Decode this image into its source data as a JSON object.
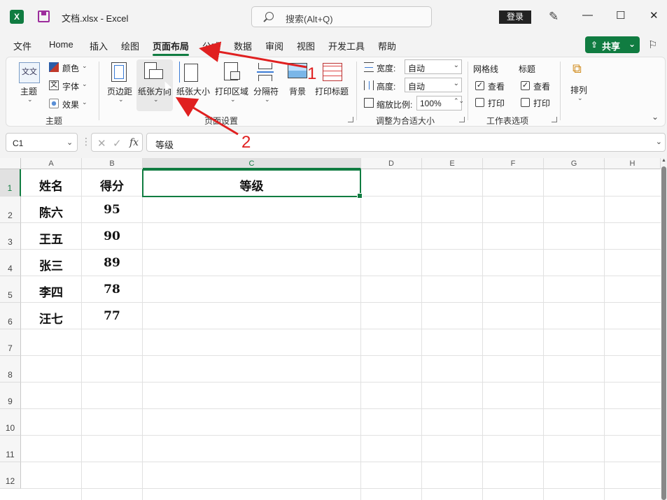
{
  "window": {
    "title": "文档.xlsx  -  Excel",
    "app_icon": "X",
    "search_placeholder": "搜索(Alt+Q)",
    "login_label": "登录",
    "pen_icon": "✎",
    "minimize": "—",
    "maximize": "☐",
    "close": "✕"
  },
  "menu": {
    "tabs": [
      "文件",
      "Home",
      "插入",
      "绘图",
      "页面布局",
      "公式",
      "数据",
      "审阅",
      "视图",
      "开发工具",
      "帮助"
    ],
    "active_tab": "页面布局",
    "share_label": "共享",
    "share_icon": "⇪",
    "share_caret": "⌄",
    "comments_icon": "⚐"
  },
  "ribbon": {
    "theme_group": {
      "label": "主题",
      "theme": "主题",
      "colors": "颜色",
      "fonts": "字体",
      "effects": "效果",
      "theme_glyph": "文文",
      "fonts_glyph": "文"
    },
    "page_setup_group": {
      "label": "页面设置",
      "margins": "页边距",
      "orientation": "纸张方向",
      "size": "纸张大小",
      "print_area": "打印区域",
      "breaks": "分隔符",
      "background": "背景",
      "print_titles": "打印标题"
    },
    "scale_group": {
      "label": "调整为合适大小",
      "width_label": "宽度:",
      "width_value": "自动",
      "height_label": "高度:",
      "height_value": "自动",
      "scale_label": "缩放比例:",
      "scale_value": "100%"
    },
    "sheet_options_group": {
      "label": "工作表选项",
      "gridlines_label": "网格线",
      "headings_label": "标题",
      "view_label": "查看",
      "print_label": "打印",
      "gridlines_view": true,
      "gridlines_print": false,
      "headings_view": true,
      "headings_print": false,
      "check_mark": "✓"
    },
    "arrange": {
      "label": "排列",
      "icon_glyph": "⧉"
    },
    "caret": "⌄",
    "spin_caret": "⌄",
    "spin_arrows": "⌃⌄",
    "collapse_caret": "⌄"
  },
  "formula_bar": {
    "cell_ref": "C1",
    "formula": "等级",
    "cancel_glyph": "✕",
    "enter_glyph": "✓",
    "fx_label": "fx",
    "more_glyph": "⋮"
  },
  "sheet": {
    "columns": [
      "A",
      "B",
      "C",
      "D",
      "E",
      "F",
      "G",
      "H"
    ],
    "rows": [
      "1",
      "2",
      "3",
      "4",
      "5",
      "6",
      "7",
      "8",
      "9",
      "10",
      "11",
      "12"
    ],
    "selected_column": "C",
    "selected_row": "1",
    "cells": [
      [
        "姓名",
        "得分",
        "等级"
      ],
      [
        "陈六",
        "95",
        ""
      ],
      [
        "王五",
        "90",
        ""
      ],
      [
        "张三",
        "89",
        ""
      ],
      [
        "李四",
        "78",
        ""
      ],
      [
        "汪七",
        "77",
        ""
      ]
    ],
    "scroll_up": "▲"
  },
  "annotations": {
    "marker_1": "1",
    "marker_2": "2",
    "arrow_color": "#e02020"
  },
  "colors": {
    "accent": "#107c41",
    "annotation": "#e02020"
  }
}
